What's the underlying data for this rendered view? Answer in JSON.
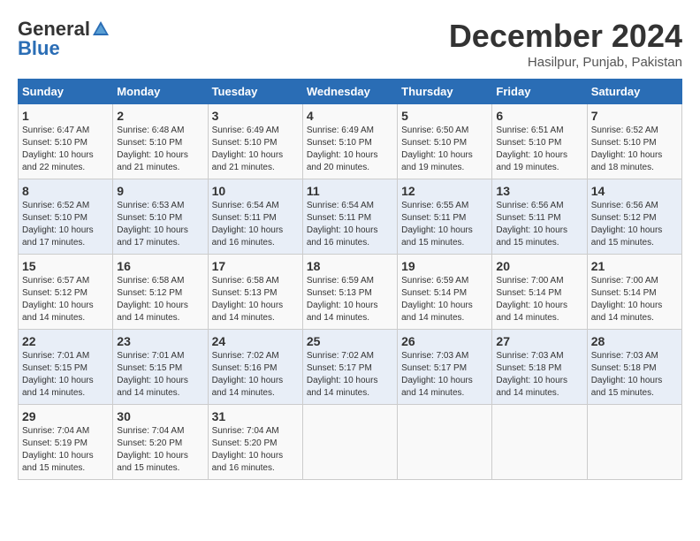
{
  "logo": {
    "general": "General",
    "blue": "Blue"
  },
  "title": {
    "month": "December 2024",
    "location": "Hasilpur, Punjab, Pakistan"
  },
  "calendar": {
    "headers": [
      "Sunday",
      "Monday",
      "Tuesday",
      "Wednesday",
      "Thursday",
      "Friday",
      "Saturday"
    ],
    "weeks": [
      [
        {
          "day": "1",
          "info": "Sunrise: 6:47 AM\nSunset: 5:10 PM\nDaylight: 10 hours\nand 22 minutes."
        },
        {
          "day": "2",
          "info": "Sunrise: 6:48 AM\nSunset: 5:10 PM\nDaylight: 10 hours\nand 21 minutes."
        },
        {
          "day": "3",
          "info": "Sunrise: 6:49 AM\nSunset: 5:10 PM\nDaylight: 10 hours\nand 21 minutes."
        },
        {
          "day": "4",
          "info": "Sunrise: 6:49 AM\nSunset: 5:10 PM\nDaylight: 10 hours\nand 20 minutes."
        },
        {
          "day": "5",
          "info": "Sunrise: 6:50 AM\nSunset: 5:10 PM\nDaylight: 10 hours\nand 19 minutes."
        },
        {
          "day": "6",
          "info": "Sunrise: 6:51 AM\nSunset: 5:10 PM\nDaylight: 10 hours\nand 19 minutes."
        },
        {
          "day": "7",
          "info": "Sunrise: 6:52 AM\nSunset: 5:10 PM\nDaylight: 10 hours\nand 18 minutes."
        }
      ],
      [
        {
          "day": "8",
          "info": "Sunrise: 6:52 AM\nSunset: 5:10 PM\nDaylight: 10 hours\nand 17 minutes."
        },
        {
          "day": "9",
          "info": "Sunrise: 6:53 AM\nSunset: 5:10 PM\nDaylight: 10 hours\nand 17 minutes."
        },
        {
          "day": "10",
          "info": "Sunrise: 6:54 AM\nSunset: 5:11 PM\nDaylight: 10 hours\nand 16 minutes."
        },
        {
          "day": "11",
          "info": "Sunrise: 6:54 AM\nSunset: 5:11 PM\nDaylight: 10 hours\nand 16 minutes."
        },
        {
          "day": "12",
          "info": "Sunrise: 6:55 AM\nSunset: 5:11 PM\nDaylight: 10 hours\nand 15 minutes."
        },
        {
          "day": "13",
          "info": "Sunrise: 6:56 AM\nSunset: 5:11 PM\nDaylight: 10 hours\nand 15 minutes."
        },
        {
          "day": "14",
          "info": "Sunrise: 6:56 AM\nSunset: 5:12 PM\nDaylight: 10 hours\nand 15 minutes."
        }
      ],
      [
        {
          "day": "15",
          "info": "Sunrise: 6:57 AM\nSunset: 5:12 PM\nDaylight: 10 hours\nand 14 minutes."
        },
        {
          "day": "16",
          "info": "Sunrise: 6:58 AM\nSunset: 5:12 PM\nDaylight: 10 hours\nand 14 minutes."
        },
        {
          "day": "17",
          "info": "Sunrise: 6:58 AM\nSunset: 5:13 PM\nDaylight: 10 hours\nand 14 minutes."
        },
        {
          "day": "18",
          "info": "Sunrise: 6:59 AM\nSunset: 5:13 PM\nDaylight: 10 hours\nand 14 minutes."
        },
        {
          "day": "19",
          "info": "Sunrise: 6:59 AM\nSunset: 5:14 PM\nDaylight: 10 hours\nand 14 minutes."
        },
        {
          "day": "20",
          "info": "Sunrise: 7:00 AM\nSunset: 5:14 PM\nDaylight: 10 hours\nand 14 minutes."
        },
        {
          "day": "21",
          "info": "Sunrise: 7:00 AM\nSunset: 5:14 PM\nDaylight: 10 hours\nand 14 minutes."
        }
      ],
      [
        {
          "day": "22",
          "info": "Sunrise: 7:01 AM\nSunset: 5:15 PM\nDaylight: 10 hours\nand 14 minutes."
        },
        {
          "day": "23",
          "info": "Sunrise: 7:01 AM\nSunset: 5:15 PM\nDaylight: 10 hours\nand 14 minutes."
        },
        {
          "day": "24",
          "info": "Sunrise: 7:02 AM\nSunset: 5:16 PM\nDaylight: 10 hours\nand 14 minutes."
        },
        {
          "day": "25",
          "info": "Sunrise: 7:02 AM\nSunset: 5:17 PM\nDaylight: 10 hours\nand 14 minutes."
        },
        {
          "day": "26",
          "info": "Sunrise: 7:03 AM\nSunset: 5:17 PM\nDaylight: 10 hours\nand 14 minutes."
        },
        {
          "day": "27",
          "info": "Sunrise: 7:03 AM\nSunset: 5:18 PM\nDaylight: 10 hours\nand 14 minutes."
        },
        {
          "day": "28",
          "info": "Sunrise: 7:03 AM\nSunset: 5:18 PM\nDaylight: 10 hours\nand 15 minutes."
        }
      ],
      [
        {
          "day": "29",
          "info": "Sunrise: 7:04 AM\nSunset: 5:19 PM\nDaylight: 10 hours\nand 15 minutes."
        },
        {
          "day": "30",
          "info": "Sunrise: 7:04 AM\nSunset: 5:20 PM\nDaylight: 10 hours\nand 15 minutes."
        },
        {
          "day": "31",
          "info": "Sunrise: 7:04 AM\nSunset: 5:20 PM\nDaylight: 10 hours\nand 16 minutes."
        },
        {
          "day": "",
          "info": ""
        },
        {
          "day": "",
          "info": ""
        },
        {
          "day": "",
          "info": ""
        },
        {
          "day": "",
          "info": ""
        }
      ]
    ]
  }
}
